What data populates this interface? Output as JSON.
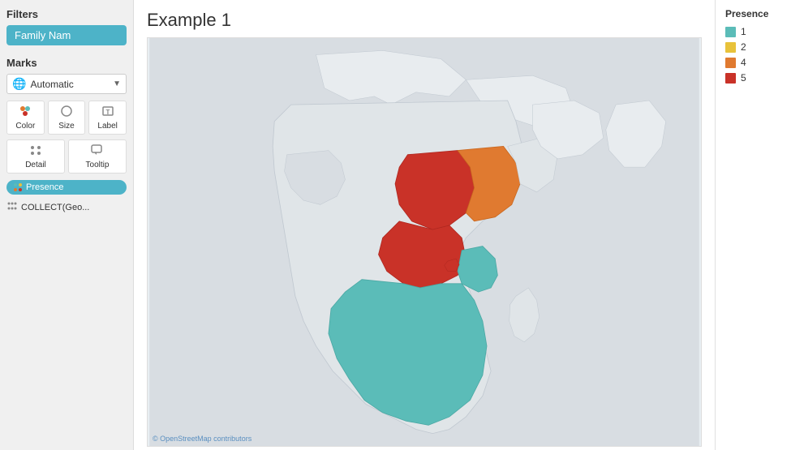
{
  "left": {
    "filters_title": "Filters",
    "filter_btn_label": "Family Nam",
    "marks_title": "Marks",
    "dropdown_label": "Automatic",
    "mark_buttons": [
      {
        "id": "color",
        "label": "Color"
      },
      {
        "id": "size",
        "label": "Size"
      },
      {
        "id": "label",
        "label": "Label"
      },
      {
        "id": "detail",
        "label": "Detail"
      },
      {
        "id": "tooltip",
        "label": "Tooltip"
      }
    ],
    "pill1_label": "Presence",
    "pill2_label": "COLLECT(Geo..."
  },
  "main": {
    "title": "Example 1",
    "attribution": "© OpenStreetMap contributors"
  },
  "legend": {
    "title": "Presence",
    "items": [
      {
        "value": "1",
        "color": "#5bbcb8"
      },
      {
        "value": "2",
        "color": "#e8c23a"
      },
      {
        "value": "4",
        "color": "#e07a30"
      },
      {
        "value": "5",
        "color": "#c93228"
      }
    ]
  }
}
